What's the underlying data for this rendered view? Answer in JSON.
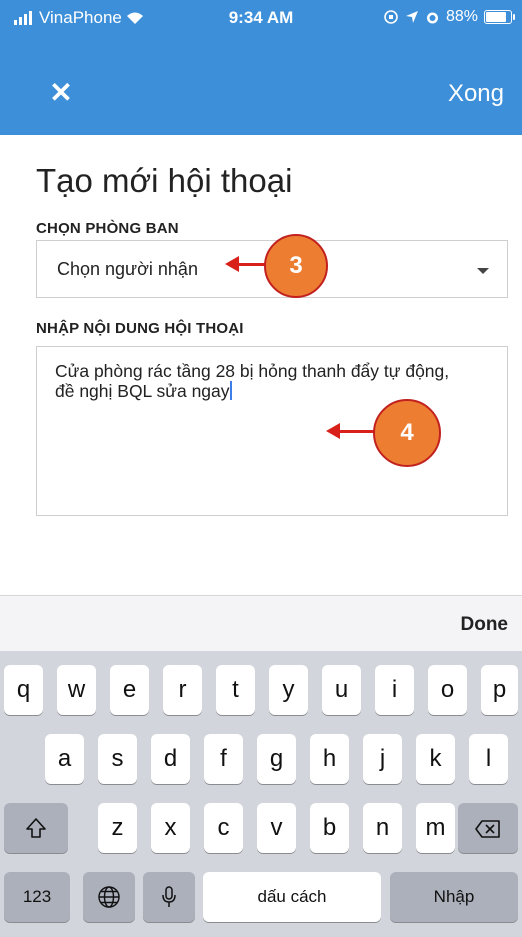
{
  "status_bar": {
    "carrier": "VinaPhone",
    "time": "9:34 AM",
    "battery": "88%"
  },
  "header": {
    "close_icon": "close-icon",
    "done_label": "Xong"
  },
  "page": {
    "title": "Tạo mới hội thoại",
    "department_label": "CHỌN PHÒNG BAN",
    "recipient_value": "Chọn người nhận",
    "content_label": "NHẬP NỘI DUNG HỘI THOẠI",
    "content_line1": "Cửa phòng rác tầng 28 bị hỏng thanh đẩy tự động,",
    "content_line2": "đề nghị BQL sửa ngay"
  },
  "annotations": {
    "step_3": "3",
    "step_4": "4"
  },
  "keyboard": {
    "accessory_done": "Done",
    "row1": [
      "q",
      "w",
      "e",
      "r",
      "t",
      "y",
      "u",
      "i",
      "o",
      "p"
    ],
    "row2": [
      "a",
      "s",
      "d",
      "f",
      "g",
      "h",
      "j",
      "k",
      "l"
    ],
    "row3": [
      "z",
      "x",
      "c",
      "v",
      "b",
      "n",
      "m"
    ],
    "numbers_key": "123",
    "space_key": "dấu cách",
    "return_key": "Nhập"
  },
  "colors": {
    "header_bg": "#3d8fd9",
    "annotation_circle": "#ed7d31",
    "annotation_arrow": "#d8211a"
  }
}
